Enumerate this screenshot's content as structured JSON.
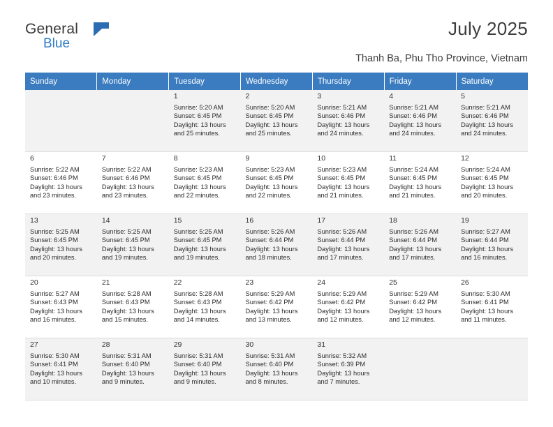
{
  "brand": {
    "word1": "General",
    "word2": "Blue",
    "logo_icon": "flag-triangle-icon",
    "accent": "#2b6cb3"
  },
  "header": {
    "title": "July 2025",
    "subtitle": "Thanh Ba, Phu Tho Province, Vietnam"
  },
  "calendar": {
    "header_bg": "#3b7cc0",
    "weekdays": [
      "Sunday",
      "Monday",
      "Tuesday",
      "Wednesday",
      "Thursday",
      "Friday",
      "Saturday"
    ],
    "weeks": [
      [
        {
          "day": "",
          "lines": []
        },
        {
          "day": "",
          "lines": []
        },
        {
          "day": "1",
          "lines": [
            "Sunrise: 5:20 AM",
            "Sunset: 6:45 PM",
            "Daylight: 13 hours",
            "and 25 minutes."
          ]
        },
        {
          "day": "2",
          "lines": [
            "Sunrise: 5:20 AM",
            "Sunset: 6:45 PM",
            "Daylight: 13 hours",
            "and 25 minutes."
          ]
        },
        {
          "day": "3",
          "lines": [
            "Sunrise: 5:21 AM",
            "Sunset: 6:46 PM",
            "Daylight: 13 hours",
            "and 24 minutes."
          ]
        },
        {
          "day": "4",
          "lines": [
            "Sunrise: 5:21 AM",
            "Sunset: 6:46 PM",
            "Daylight: 13 hours",
            "and 24 minutes."
          ]
        },
        {
          "day": "5",
          "lines": [
            "Sunrise: 5:21 AM",
            "Sunset: 6:46 PM",
            "Daylight: 13 hours",
            "and 24 minutes."
          ]
        }
      ],
      [
        {
          "day": "6",
          "lines": [
            "Sunrise: 5:22 AM",
            "Sunset: 6:46 PM",
            "Daylight: 13 hours",
            "and 23 minutes."
          ]
        },
        {
          "day": "7",
          "lines": [
            "Sunrise: 5:22 AM",
            "Sunset: 6:46 PM",
            "Daylight: 13 hours",
            "and 23 minutes."
          ]
        },
        {
          "day": "8",
          "lines": [
            "Sunrise: 5:23 AM",
            "Sunset: 6:45 PM",
            "Daylight: 13 hours",
            "and 22 minutes."
          ]
        },
        {
          "day": "9",
          "lines": [
            "Sunrise: 5:23 AM",
            "Sunset: 6:45 PM",
            "Daylight: 13 hours",
            "and 22 minutes."
          ]
        },
        {
          "day": "10",
          "lines": [
            "Sunrise: 5:23 AM",
            "Sunset: 6:45 PM",
            "Daylight: 13 hours",
            "and 21 minutes."
          ]
        },
        {
          "day": "11",
          "lines": [
            "Sunrise: 5:24 AM",
            "Sunset: 6:45 PM",
            "Daylight: 13 hours",
            "and 21 minutes."
          ]
        },
        {
          "day": "12",
          "lines": [
            "Sunrise: 5:24 AM",
            "Sunset: 6:45 PM",
            "Daylight: 13 hours",
            "and 20 minutes."
          ]
        }
      ],
      [
        {
          "day": "13",
          "lines": [
            "Sunrise: 5:25 AM",
            "Sunset: 6:45 PM",
            "Daylight: 13 hours",
            "and 20 minutes."
          ]
        },
        {
          "day": "14",
          "lines": [
            "Sunrise: 5:25 AM",
            "Sunset: 6:45 PM",
            "Daylight: 13 hours",
            "and 19 minutes."
          ]
        },
        {
          "day": "15",
          "lines": [
            "Sunrise: 5:25 AM",
            "Sunset: 6:45 PM",
            "Daylight: 13 hours",
            "and 19 minutes."
          ]
        },
        {
          "day": "16",
          "lines": [
            "Sunrise: 5:26 AM",
            "Sunset: 6:44 PM",
            "Daylight: 13 hours",
            "and 18 minutes."
          ]
        },
        {
          "day": "17",
          "lines": [
            "Sunrise: 5:26 AM",
            "Sunset: 6:44 PM",
            "Daylight: 13 hours",
            "and 17 minutes."
          ]
        },
        {
          "day": "18",
          "lines": [
            "Sunrise: 5:26 AM",
            "Sunset: 6:44 PM",
            "Daylight: 13 hours",
            "and 17 minutes."
          ]
        },
        {
          "day": "19",
          "lines": [
            "Sunrise: 5:27 AM",
            "Sunset: 6:44 PM",
            "Daylight: 13 hours",
            "and 16 minutes."
          ]
        }
      ],
      [
        {
          "day": "20",
          "lines": [
            "Sunrise: 5:27 AM",
            "Sunset: 6:43 PM",
            "Daylight: 13 hours",
            "and 16 minutes."
          ]
        },
        {
          "day": "21",
          "lines": [
            "Sunrise: 5:28 AM",
            "Sunset: 6:43 PM",
            "Daylight: 13 hours",
            "and 15 minutes."
          ]
        },
        {
          "day": "22",
          "lines": [
            "Sunrise: 5:28 AM",
            "Sunset: 6:43 PM",
            "Daylight: 13 hours",
            "and 14 minutes."
          ]
        },
        {
          "day": "23",
          "lines": [
            "Sunrise: 5:29 AM",
            "Sunset: 6:42 PM",
            "Daylight: 13 hours",
            "and 13 minutes."
          ]
        },
        {
          "day": "24",
          "lines": [
            "Sunrise: 5:29 AM",
            "Sunset: 6:42 PM",
            "Daylight: 13 hours",
            "and 12 minutes."
          ]
        },
        {
          "day": "25",
          "lines": [
            "Sunrise: 5:29 AM",
            "Sunset: 6:42 PM",
            "Daylight: 13 hours",
            "and 12 minutes."
          ]
        },
        {
          "day": "26",
          "lines": [
            "Sunrise: 5:30 AM",
            "Sunset: 6:41 PM",
            "Daylight: 13 hours",
            "and 11 minutes."
          ]
        }
      ],
      [
        {
          "day": "27",
          "lines": [
            "Sunrise: 5:30 AM",
            "Sunset: 6:41 PM",
            "Daylight: 13 hours",
            "and 10 minutes."
          ]
        },
        {
          "day": "28",
          "lines": [
            "Sunrise: 5:31 AM",
            "Sunset: 6:40 PM",
            "Daylight: 13 hours",
            "and 9 minutes."
          ]
        },
        {
          "day": "29",
          "lines": [
            "Sunrise: 5:31 AM",
            "Sunset: 6:40 PM",
            "Daylight: 13 hours",
            "and 9 minutes."
          ]
        },
        {
          "day": "30",
          "lines": [
            "Sunrise: 5:31 AM",
            "Sunset: 6:40 PM",
            "Daylight: 13 hours",
            "and 8 minutes."
          ]
        },
        {
          "day": "31",
          "lines": [
            "Sunrise: 5:32 AM",
            "Sunset: 6:39 PM",
            "Daylight: 13 hours",
            "and 7 minutes."
          ]
        },
        {
          "day": "",
          "lines": []
        },
        {
          "day": "",
          "lines": []
        }
      ]
    ]
  }
}
